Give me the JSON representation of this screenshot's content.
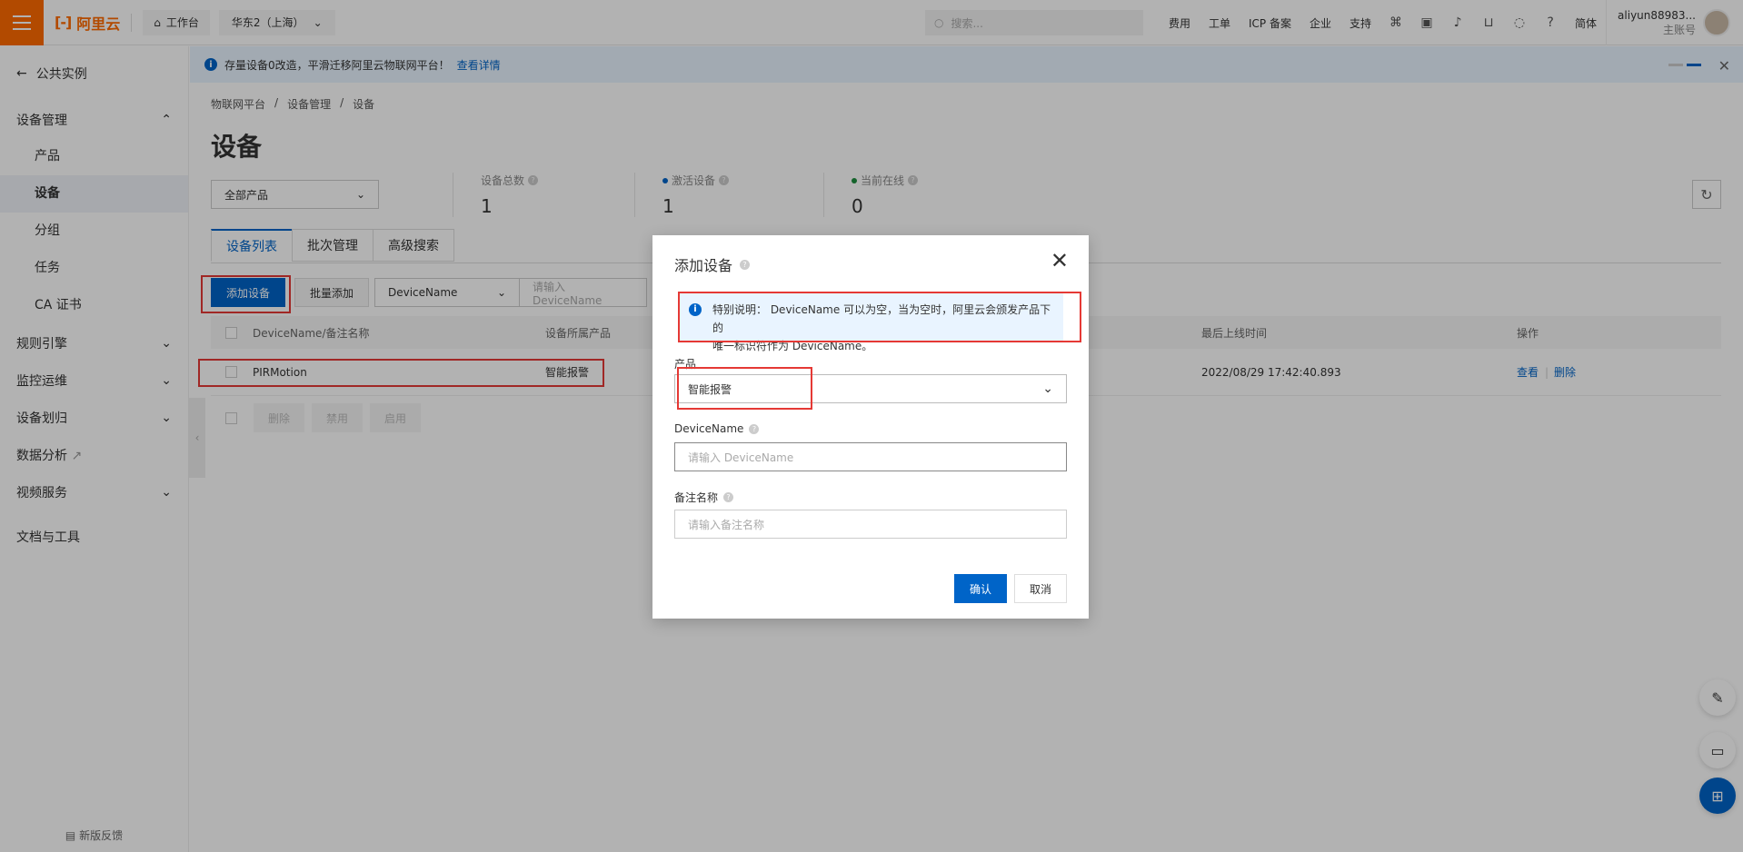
{
  "topbar": {
    "brand": "阿里云",
    "workbench": "工作台",
    "region": "华东2（上海）",
    "search_placeholder": "搜索...",
    "links": [
      "费用",
      "工单",
      "ICP 备案",
      "企业",
      "支持"
    ],
    "lang": "简体",
    "user_name": "aliyun88983...",
    "user_role": "主账号"
  },
  "sidebar": {
    "back": "公共实例",
    "group_device": "设备管理",
    "items": [
      "产品",
      "设备",
      "分组",
      "任务",
      "CA 证书"
    ],
    "groups": [
      "规则引擎",
      "监控运维",
      "设备划归",
      "数据分析",
      "视频服务",
      "文档与工具"
    ],
    "feedback": "新版反馈"
  },
  "notice": {
    "text": "存量设备0改造，平滑迁移阿里云物联网平台！",
    "link": "查看详情"
  },
  "breadcrumb": [
    "物联网平台",
    "/",
    "设备管理",
    "/",
    "设备"
  ],
  "page": {
    "title": "设备",
    "product_filter": "全部产品",
    "stats": [
      {
        "label": "设备总数",
        "value": "1"
      },
      {
        "label": "激活设备",
        "value": "1"
      },
      {
        "label": "当前在线",
        "value": "0"
      }
    ]
  },
  "tabs": [
    "设备列表",
    "批次管理",
    "高级搜索"
  ],
  "toolbar": {
    "add": "添加设备",
    "batch_add": "批量添加",
    "filter_field": "DeviceName",
    "filter_placeholder": "请输入 DeviceName"
  },
  "table": {
    "headers": [
      "DeviceName/备注名称",
      "设备所属产品",
      "最后上线时间",
      "操作"
    ],
    "row": {
      "name": "PIRMotion",
      "product": "智能报警",
      "last_online": "2022/08/29 17:42:40.893",
      "view": "查看",
      "delete": "删除"
    },
    "bulk": [
      "删除",
      "禁用",
      "启用"
    ]
  },
  "modal": {
    "title": "添加设备",
    "alert_line1": "特别说明： DeviceName 可以为空，当为空时，阿里云会颁发产品下的",
    "alert_line2": "唯一标识符作为 DeviceName。",
    "product_label": "产品",
    "product_value": "智能报警",
    "devicename_label": "DeviceName",
    "devicename_placeholder": "请输入 DeviceName",
    "remark_label": "备注名称",
    "remark_placeholder": "请输入备注名称",
    "confirm": "确认",
    "cancel": "取消"
  },
  "colors": {
    "brand": "#ff6a00",
    "primary": "#0064c8",
    "annotation": "#e53935"
  }
}
